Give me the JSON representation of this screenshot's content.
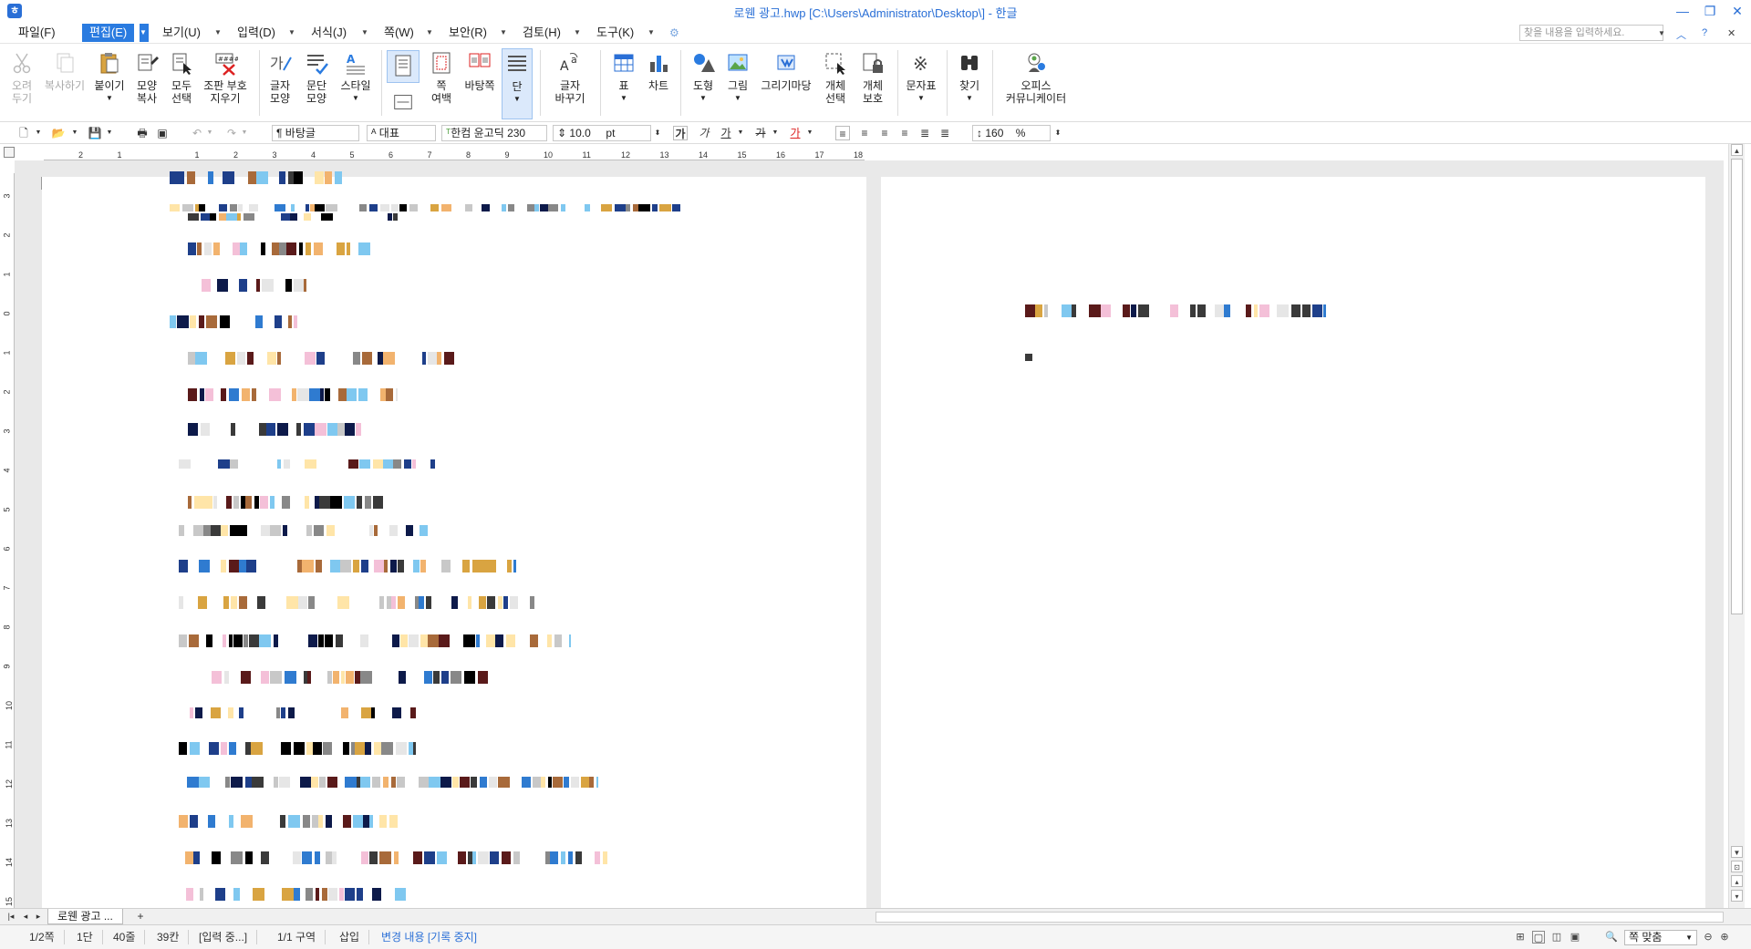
{
  "titlebar": {
    "app_icon": "hwp-app-icon",
    "title": "로웬 광고.hwp [C:\\Users\\Administrator\\Desktop\\] - 한글",
    "minimize": "—",
    "restore": "❐",
    "close": "✕"
  },
  "menubar": {
    "items": [
      {
        "label": "파일(F)"
      },
      {
        "label": "편집(E)"
      },
      {
        "label": "보기(U)"
      },
      {
        "label": "입력(D)"
      },
      {
        "label": "서식(J)"
      },
      {
        "label": "쪽(W)"
      },
      {
        "label": "보안(R)"
      },
      {
        "label": "검토(H)"
      },
      {
        "label": "도구(K)"
      }
    ],
    "search_placeholder": "찾을 내용을 입력하세요.",
    "help": "?"
  },
  "ribbon": {
    "cut": {
      "line1": "오려",
      "line2": "두기"
    },
    "copy": {
      "line1": "복사하기"
    },
    "paste": {
      "line1": "붙이기"
    },
    "format_copy": {
      "line1": "모양",
      "line2": "복사"
    },
    "select_all": {
      "line1": "모두",
      "line2": "선택"
    },
    "erase_codes": {
      "line1": "조판 부호",
      "line2": "지우기"
    },
    "char_shape": {
      "line1": "글자",
      "line2": "모양"
    },
    "para_shape": {
      "line1": "문단",
      "line2": "모양"
    },
    "style": {
      "line1": "스타일"
    },
    "margin": {
      "line1": "쪽",
      "line2": "여백"
    },
    "background": {
      "line1": "바탕쪽"
    },
    "column": {
      "line1": "단"
    },
    "replace_char": {
      "line1": "글자",
      "line2": "바꾸기"
    },
    "table": {
      "line1": "표"
    },
    "chart": {
      "line1": "차트"
    },
    "shape": {
      "line1": "도형"
    },
    "picture": {
      "line1": "그림"
    },
    "drawing_market": {
      "line1": "그리기마당"
    },
    "object_select": {
      "line1": "개체",
      "line2": "선택"
    },
    "object_protect": {
      "line1": "개체",
      "line2": "보호"
    },
    "symbols": {
      "line1": "문자표"
    },
    "find": {
      "line1": "찾기"
    },
    "office_comm": {
      "line1": "오피스",
      "line2": "커뮤니케이터"
    }
  },
  "formatbar": {
    "style_value": "바탕글",
    "lang_value": "대표",
    "font_value": "한컴 윤고딕 230",
    "size_value": "10.0",
    "size_unit": "pt",
    "bold_glyph": "가",
    "italic_glyph": "가",
    "underline_glyph": "가",
    "strike_glyph": "가",
    "color_glyph": "가",
    "line_spacing": "160",
    "line_spacing_unit": "%"
  },
  "ruler": {
    "h_ticks": [
      "2",
      "1",
      "",
      "1",
      "2",
      "3",
      "4",
      "5",
      "6",
      "7",
      "8",
      "9",
      "10",
      "11",
      "12",
      "13",
      "14",
      "15",
      "16",
      "17",
      "18"
    ],
    "v_ticks": [
      "3",
      "2",
      "1",
      "0",
      "1",
      "2",
      "3",
      "4",
      "5",
      "6",
      "7",
      "8",
      "9",
      "10",
      "11",
      "12",
      "13",
      "14",
      "15"
    ]
  },
  "tabs": {
    "doc_tab": "로웬 광고"
  },
  "statusbar": {
    "page": "1/2쪽",
    "column": "1단",
    "line": "40줄",
    "col": "39칸",
    "input_mode": "[입력 중...]",
    "section": "1/1 구역",
    "insert_mode": "삽입",
    "track_changes": "변경 내용 [기록 중지]",
    "zoom": "쪽 맞춤"
  },
  "colors": {
    "accent": "#2a7be0",
    "title_text": "#2a6fd6"
  }
}
